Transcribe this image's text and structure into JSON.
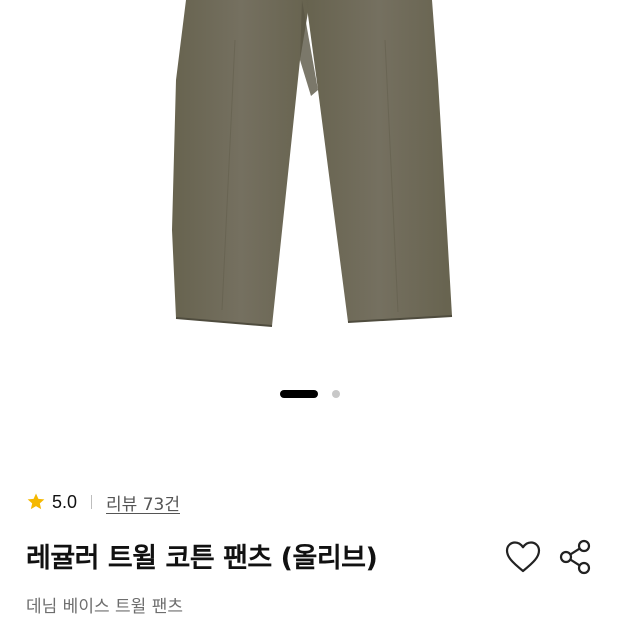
{
  "product": {
    "image_alt": "olive regular twill cotton pants",
    "pants_color": "#6e6a5c",
    "carousel": {
      "active_index": 1,
      "total": 2
    }
  },
  "rating": {
    "score": "5.0",
    "review_link": "리뷰 73건",
    "star_color": "#f5b800"
  },
  "title": "레귤러 트윌 코튼 팬츠 (올리브)",
  "subtitle": "데님 베이스 트윌 팬츠",
  "actions": {
    "like_icon": "heart-outline-icon",
    "share_icon": "share-icon"
  }
}
